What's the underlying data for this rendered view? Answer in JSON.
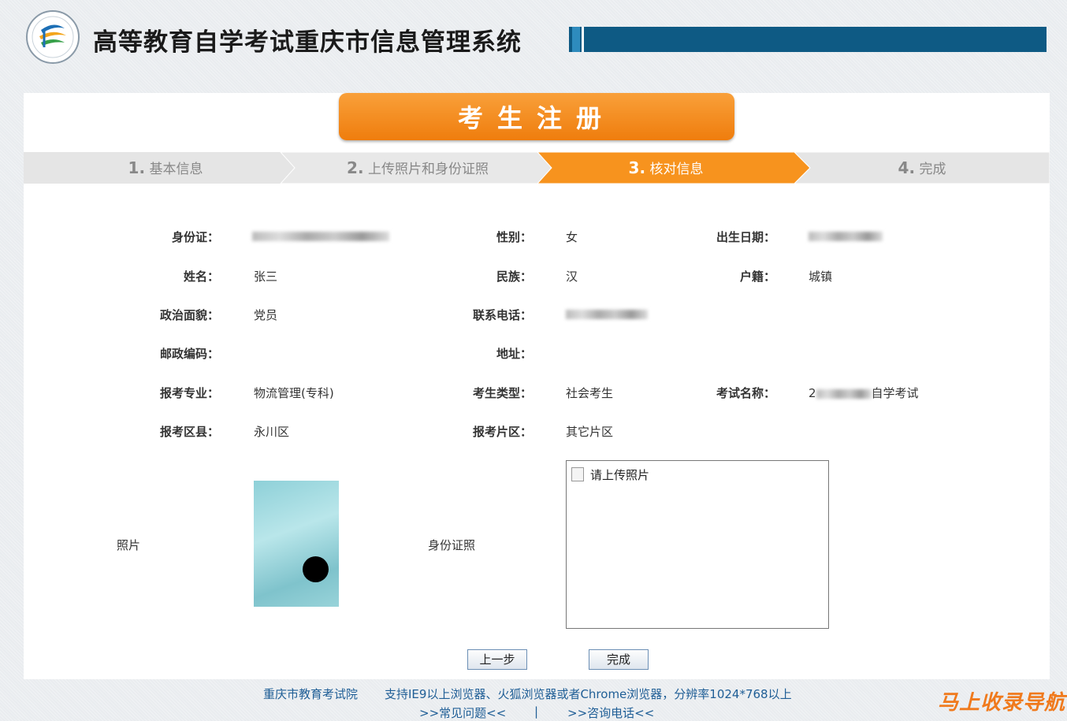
{
  "header": {
    "title": "高等教育自学考试重庆市信息管理系统"
  },
  "registration": {
    "title": "考生注册"
  },
  "steps": [
    {
      "num": "1.",
      "label": "基本信息"
    },
    {
      "num": "2.",
      "label": "上传照片和身份证照"
    },
    {
      "num": "3.",
      "label": "核对信息"
    },
    {
      "num": "4.",
      "label": "完成"
    }
  ],
  "active_step": 3,
  "fields": {
    "id_card": {
      "label": "身份证：",
      "value": ""
    },
    "gender": {
      "label": "性别：",
      "value": "女"
    },
    "birth_date": {
      "label": "出生日期：",
      "value": ""
    },
    "name": {
      "label": "姓名：",
      "value": "张三"
    },
    "ethnicity": {
      "label": "民族：",
      "value": "汉"
    },
    "household": {
      "label": "户籍：",
      "value": "城镇"
    },
    "political": {
      "label": "政治面貌：",
      "value": "党员"
    },
    "phone": {
      "label": "联系电话：",
      "value": ""
    },
    "postal": {
      "label": "邮政编码：",
      "value": ""
    },
    "address": {
      "label": "地址：",
      "value": ""
    },
    "major": {
      "label": "报考专业：",
      "value": "物流管理(专科)"
    },
    "candidate_type": {
      "label": "考生类型：",
      "value": "社会考生"
    },
    "exam_name": {
      "label": "考试名称：",
      "value_prefix": "2",
      "value_suffix": "自学考试"
    },
    "district": {
      "label": "报考区县：",
      "value": "永川区"
    },
    "area": {
      "label": "报考片区：",
      "value": "其它片区"
    }
  },
  "photo": {
    "label": "照片"
  },
  "id_photo": {
    "label": "身份证照",
    "placeholder": "请上传照片"
  },
  "buttons": {
    "prev": "上一步",
    "finish": "完成"
  },
  "footer": {
    "org": "重庆市教育考试院",
    "browser_note": "支持IE9以上浏览器、火狐浏览器或者Chrome浏览器，分辨率1024*768以上",
    "faq_link": ">>常见问题<<",
    "separator": "|",
    "phone_link": ">>咨询电话<<"
  },
  "watermark": "马上收录导航",
  "colors": {
    "accent_orange": "#f7931e",
    "title_bar_blue": "#0e5a84",
    "footer_link": "#1f5e96"
  },
  "icons": {
    "logo": "exam-institute-logo",
    "broken_image": "broken-image-icon"
  }
}
